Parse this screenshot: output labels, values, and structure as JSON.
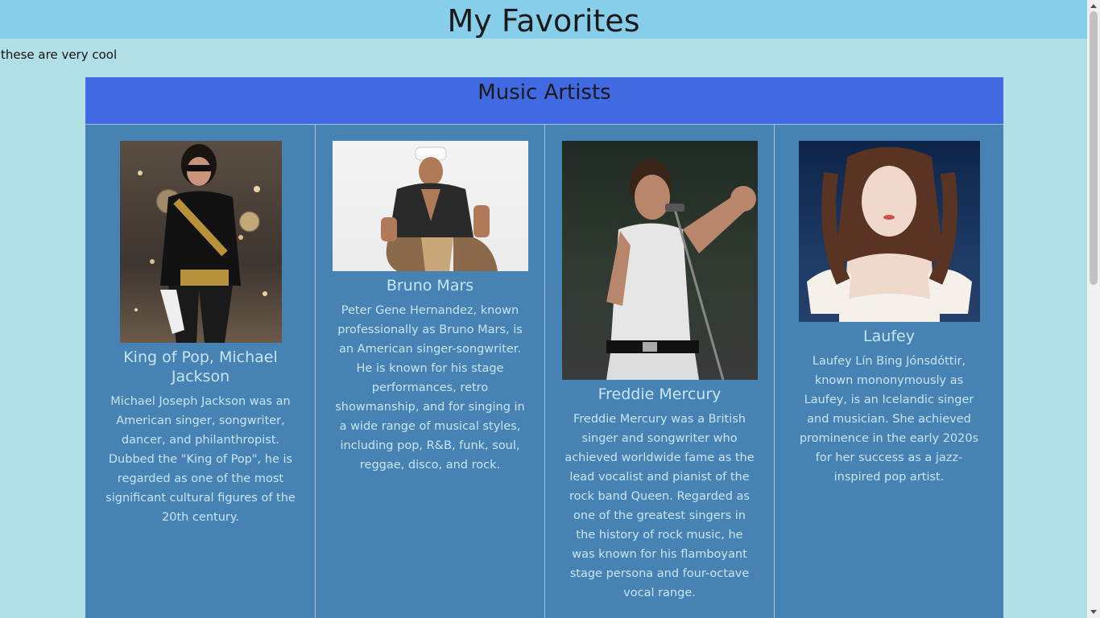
{
  "header": {
    "title": "My Favorites"
  },
  "intro": {
    "text": "these are very cool"
  },
  "section": {
    "title": "Music Artists",
    "artists": [
      {
        "name": "King of Pop, Michael Jackson",
        "photo": "michael-jackson-photo",
        "description": "Michael Joseph Jackson was an American singer, songwriter, dancer, and philanthropist. Dubbed the \"King of Pop\", he is regarded as one of the most significant cultural figures of the 20th century."
      },
      {
        "name": "Bruno Mars",
        "photo": "bruno-mars-photo",
        "description": "Peter Gene Hernandez, known professionally as Bruno Mars, is an American singer-songwriter. He is known for his stage performances, retro showmanship, and for singing in a wide range of musical styles, including pop, R&B, funk, soul, reggae, disco, and rock."
      },
      {
        "name": "Freddie Mercury",
        "photo": "freddie-mercury-photo",
        "description": "Freddie Mercury was a British singer and songwriter who achieved worldwide fame as the lead vocalist and pianist of the rock band Queen. Regarded as one of the greatest singers in the history of rock music, he was known for his flamboyant stage persona and four-octave vocal range."
      },
      {
        "name": "Laufey",
        "photo": "laufey-photo",
        "description": "Laufey Lín Bing Jónsdóttir, known mononymously as Laufey, is an Icelandic singer and musician. She achieved prominence in the early 2020s for her success as a jazz-inspired pop artist."
      }
    ]
  },
  "colors": {
    "page_background": "#b0e0e6",
    "header_background": "#87ceeb",
    "section_background": "#4682b4",
    "section_header_background": "#4169e1",
    "card_text": "#c6e6f5"
  }
}
